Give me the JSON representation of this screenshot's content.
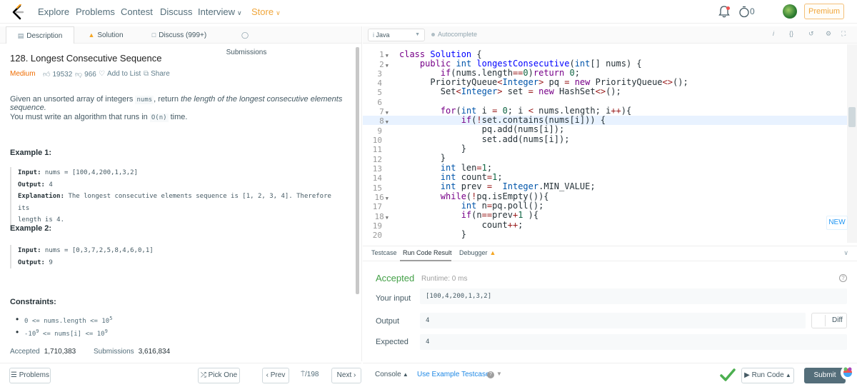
{
  "nav": {
    "items": [
      "Explore",
      "Problems",
      "Contest",
      "Discuss",
      "Interview",
      "Store"
    ],
    "coins": "0",
    "premium": "Premium"
  },
  "left_tabs": {
    "description": "Description",
    "solution": "Solution",
    "discuss": "Discuss (999+)",
    "submissions": "Submissions"
  },
  "problem": {
    "title": "128. Longest Consecutive Sequence",
    "difficulty": "Medium",
    "likes": "19532",
    "dislikes": "966",
    "add_to_list": "Add to List",
    "share": "Share",
    "desc1_a": "Given an unsorted array of integers ",
    "desc1_code": "nums",
    "desc1_b": ", return ",
    "desc1_em": "the length of the longest consecutive elements sequence.",
    "desc2_a": "You must write an algorithm that runs in ",
    "desc2_code": "O(n)",
    "desc2_b": " time.",
    "example1_h": "Example 1:",
    "example1": {
      "input_label": "Input:",
      "input": " nums = [100,4,200,1,3,2]",
      "output_label": "Output:",
      "output": " 4",
      "expl_label": "Explanation:",
      "expl1": " The longest consecutive elements sequence is [1, 2, 3, 4]. Therefore its",
      "expl2": "length is 4."
    },
    "example2_h": "Example 2:",
    "example2": {
      "input_label": "Input:",
      "input": " nums = [0,3,7,2,5,8,4,6,0,1]",
      "output_label": "Output:",
      "output": " 9"
    },
    "constraints_h": "Constraints:",
    "constraint1": "0 <= nums.length <= 10",
    "constraint1_sup": "5",
    "constraint2_a": "-10",
    "constraint2_a_sup": "9",
    "constraint2_b": " <= nums[i] <= 10",
    "constraint2_b_sup": "9",
    "accepted_label": "Accepted",
    "accepted_value": "1,710,383",
    "submissions_label": "Submissions",
    "submissions_value": "3,616,834"
  },
  "left_bottom": {
    "problems": "Problems",
    "pick_one": "Pick One",
    "prev": "Prev",
    "page": "/198",
    "next": "Next"
  },
  "editor": {
    "language": "Java",
    "autocomplete": "Autocomplete",
    "line_numbers": [
      "1",
      "2",
      "3",
      "4",
      "5",
      "6",
      "7",
      "8",
      "9",
      "10",
      "11",
      "12",
      "13",
      "14",
      "15",
      "16",
      "17",
      "18",
      "19",
      "20"
    ]
  },
  "console": {
    "tab_testcase": "Testcase",
    "tab_result": "Run Code Result",
    "tab_debugger": "Debugger",
    "status": "Accepted",
    "runtime": "Runtime: 0 ms",
    "your_input_label": "Your input",
    "your_input": "[100,4,200,1,3,2]",
    "output_label": "Output",
    "output": "4",
    "expected_label": "Expected",
    "expected": "4",
    "diff": "Diff",
    "new_badge": "NEW"
  },
  "right_bottom": {
    "console": "Console",
    "use_example": "Use Example Testcases",
    "run_code": "Run Code",
    "submit": "Submit"
  },
  "colors": {
    "accepted": "#43a047",
    "medium": "#ef6c00",
    "store": "#f0a63b",
    "link": "#1e88e5"
  }
}
